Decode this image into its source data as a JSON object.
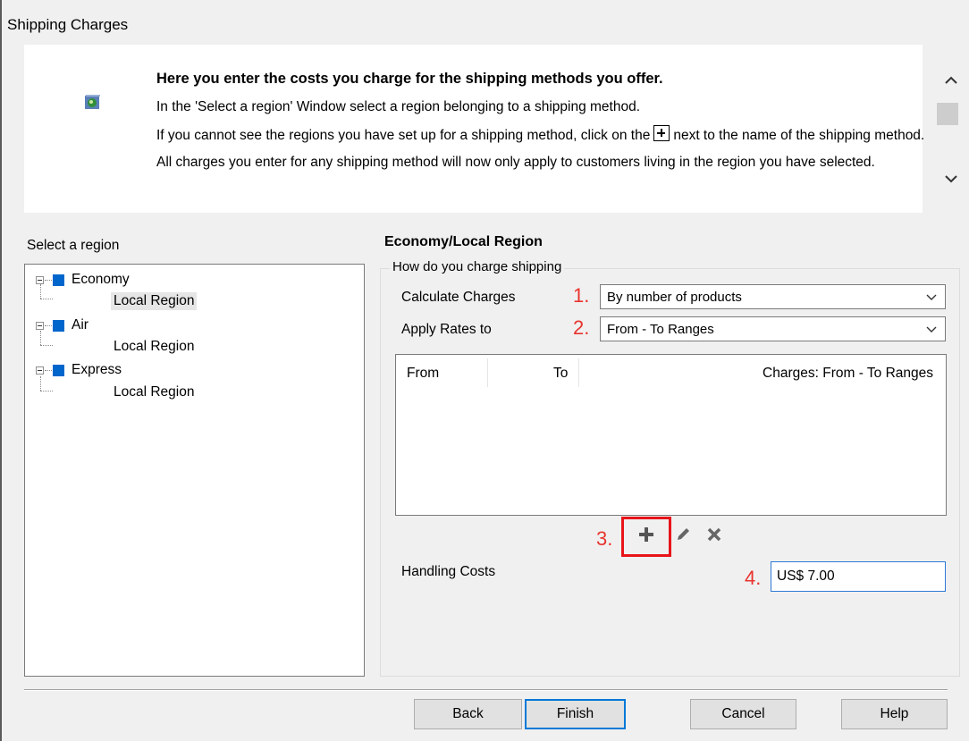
{
  "window": {
    "title": "Shipping Charges"
  },
  "info": {
    "headline": "Here you enter the costs you charge for the shipping methods you offer.",
    "line1": "In the 'Select a region' Window select a region belonging to a shipping method.",
    "line2_before": "If you cannot see the regions you have set up for a shipping method, click on the",
    "line2_after": "next to the name of the shipping method.",
    "line3": "All charges you enter for any shipping method will now only apply to customers living in the region you have selected."
  },
  "region_panel": {
    "label": "Select a region",
    "methods": [
      {
        "name": "Economy",
        "region": "Local Region",
        "selected": true
      },
      {
        "name": "Air",
        "region": "Local Region",
        "selected": false
      },
      {
        "name": "Express",
        "region": "Local Region",
        "selected": false
      }
    ]
  },
  "detail": {
    "title": "Economy/Local Region",
    "group_label": "How do you charge shipping",
    "calc_label": "Calculate Charges",
    "calc_value": "By number of products",
    "apply_label": "Apply Rates to",
    "apply_value": "From - To Ranges",
    "columns": {
      "from": "From",
      "to": "To",
      "charges": "Charges:  From - To Ranges"
    },
    "handling_label": "Handling Costs",
    "handling_value": "US$ 7.00",
    "steps": {
      "s1": "1.",
      "s2": "2.",
      "s3": "3.",
      "s4": "4."
    }
  },
  "buttons": {
    "back": "Back",
    "finish": "Finish",
    "cancel": "Cancel",
    "help": "Help"
  },
  "colors": {
    "accent": "#0078d7",
    "annotation": "#e8342e",
    "tree_square": "#0066cc"
  }
}
